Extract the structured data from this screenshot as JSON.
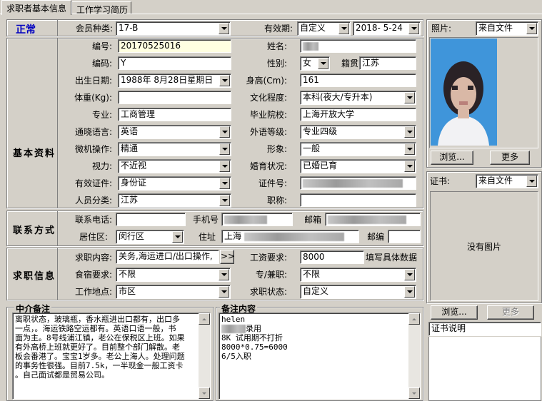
{
  "tabs": [
    "求职者基本信息",
    "工作学习简历"
  ],
  "status": "正常",
  "sections": {
    "basic": "基本资料",
    "contact": "联系方式",
    "job": "求职信息",
    "agent_note": "中介备注",
    "note_content": "备注内容"
  },
  "member": {
    "label": "会员种类:",
    "value": "17-B"
  },
  "validity": {
    "label": "有效期:",
    "type": "自定义",
    "date": "2018- 5-24"
  },
  "photo": {
    "label": "照片:",
    "source": "来自文件",
    "browse": "浏览...",
    "more": "更多"
  },
  "cert": {
    "label": "证书:",
    "source": "来自文件",
    "no_image": "没有图片",
    "browse": "浏览...",
    "more": "更多",
    "desc": "证书说明"
  },
  "fields": {
    "id": {
      "label": "编号:",
      "value": "20170525016"
    },
    "name": {
      "label": "姓名:"
    },
    "code": {
      "label": "编码:",
      "value": "Y"
    },
    "gender": {
      "label": "性别:",
      "value": "女"
    },
    "origin": {
      "label": "籍贯",
      "value": "江苏"
    },
    "birth": {
      "label": "出生日期:",
      "value": "1988年 8月28日星期日"
    },
    "height": {
      "label": "身高(Cm):",
      "value": "161"
    },
    "weight": {
      "label": "体重(Kg):",
      "value": ""
    },
    "education": {
      "label": "文化程度:",
      "value": "本科(夜大/专升本)"
    },
    "major": {
      "label": "专业:",
      "value": "工商管理"
    },
    "school": {
      "label": "毕业院校:",
      "value": "上海开放大学"
    },
    "language": {
      "label": "通晓语言:",
      "value": "英语"
    },
    "lang_level": {
      "label": "外语等级:",
      "value": "专业四级"
    },
    "computer": {
      "label": "微机操作:",
      "value": "精通"
    },
    "appearance": {
      "label": "形象:",
      "value": "一般"
    },
    "vision": {
      "label": "视力:",
      "value": "不近视"
    },
    "marital": {
      "label": "婚育状况:",
      "value": "已婚已育"
    },
    "id_type": {
      "label": "有效证件:",
      "value": "身份证"
    },
    "id_no": {
      "label": "证件号:"
    },
    "category": {
      "label": "人员分类:",
      "value": "江苏"
    },
    "title": {
      "label": "职称:",
      "value": ""
    }
  },
  "contact": {
    "phone": {
      "label": "联系电话:",
      "value": ""
    },
    "mobile": {
      "label": "手机号"
    },
    "email": {
      "label": "邮箱"
    },
    "district": {
      "label": "居住区:",
      "value": "闵行区"
    },
    "address": {
      "label": "住址",
      "value": "上海"
    },
    "zip": {
      "label": "邮编",
      "value": ""
    }
  },
  "job": {
    "position": {
      "label": "求职内容:",
      "value": "关务,海运进口/出口操作,",
      "btn": ">>"
    },
    "salary": {
      "label": "工资要求:",
      "value": "8000",
      "hint": "填写具体数据"
    },
    "board": {
      "label": "食宿要求:",
      "value": "不限"
    },
    "parttime": {
      "label": "专/兼职:",
      "value": "不限"
    },
    "location": {
      "label": "工作地点:",
      "value": "市区"
    },
    "state": {
      "label": "求职状态:",
      "value": "自定义"
    }
  },
  "agent_note_lines": [
    "离职状态，玻璃瓶，香水瓶进出口都有，出口多",
    "一点，。海运铁路空运都有。英语口语一般，书",
    "面为主。8号线浦江镇，老公在保税区上班。如果",
    "有外高桥上班就更好了。目前整个部门解散。老",
    "板会番港了。宝宝1岁多。老公上海人。处理问题",
    "的事务性很强。目前7.5k，一半现金一般工资卡",
    "。自己面试都是贸易公司。"
  ],
  "note_lines": [
    "helen",
    "录用",
    "8K 试用期不打折",
    "8000*0.75=6000",
    "6/5入职"
  ]
}
